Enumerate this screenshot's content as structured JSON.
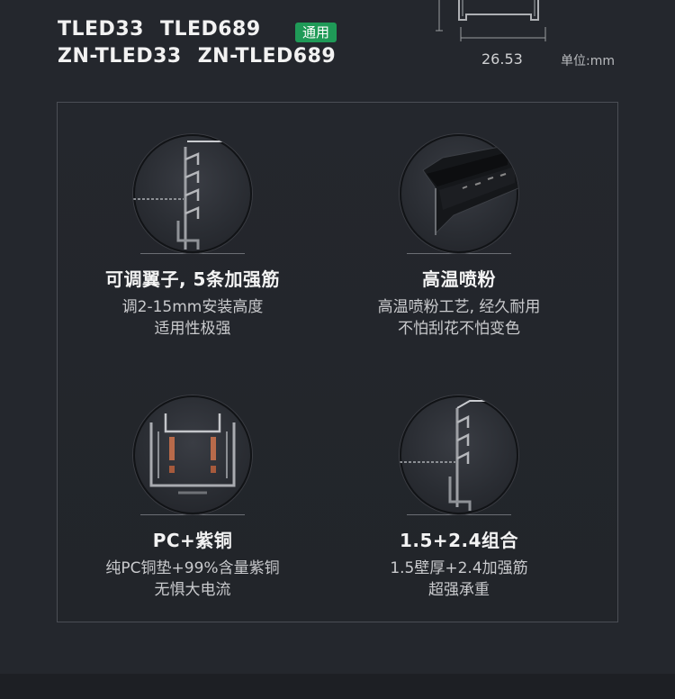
{
  "header": {
    "models_line1": [
      "TLED33",
      "TLED689"
    ],
    "models_line2": [
      "ZN-TLED33",
      "ZN-TLED689"
    ],
    "badge": "通用",
    "dimension": "26.53",
    "unit": "单位:mm"
  },
  "features": [
    {
      "title": "可调翼子, 5条加强筋",
      "desc": [
        "调2-15mm安装高度",
        "适用性极强"
      ],
      "icon": "adjustable-wing-profile-icon"
    },
    {
      "title": "高温喷粉",
      "desc": [
        "高温喷粉工艺, 经久耐用",
        "不怕刮花不怕变色"
      ],
      "icon": "powder-coated-track-icon"
    },
    {
      "title": "PC+紫铜",
      "desc": [
        "纯PC铜垫+99%含量紫铜",
        "无惧大电流"
      ],
      "icon": "copper-conductor-section-icon"
    },
    {
      "title": "1.5+2.4组合",
      "desc": [
        "1.5壁厚+2.4加强筋",
        "超强承重"
      ],
      "icon": "wall-thickness-profile-icon"
    }
  ],
  "colors": {
    "background": "#24272d",
    "badge": "#1f9a57",
    "panel_border": "#4b4e55"
  }
}
